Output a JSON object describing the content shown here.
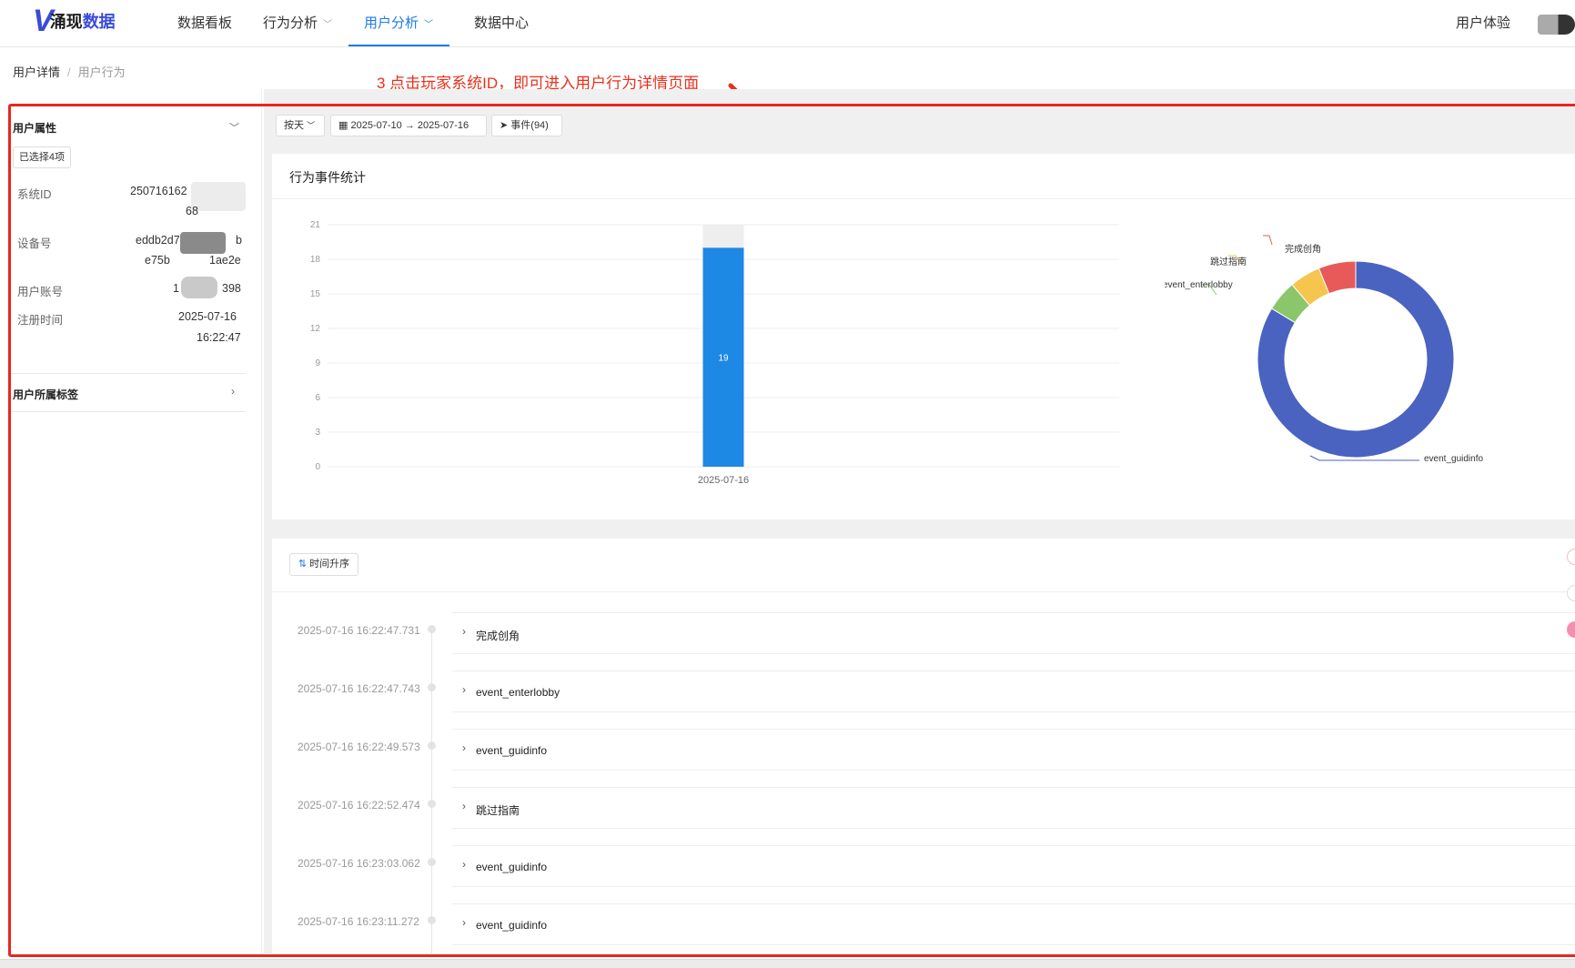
{
  "logo": {
    "mark": "V",
    "text_main": "涌现",
    "text_accent": "数据"
  },
  "nav": {
    "items": [
      {
        "label": "数据看板",
        "dropdown": false
      },
      {
        "label": "行为分析",
        "dropdown": true
      },
      {
        "label": "用户分析",
        "dropdown": true,
        "active": true
      },
      {
        "label": "数据中心",
        "dropdown": false
      }
    ],
    "user_experience": "用户体验"
  },
  "breadcrumb": {
    "current": "用户详情",
    "separator": "/",
    "sub": "用户行为"
  },
  "annotation": "3 点击玩家系统ID，即可进入用户行为详情页面",
  "user_panel": {
    "title": "用户属性",
    "selected_tag": "已选择4项",
    "attributes": [
      {
        "label": "系统ID",
        "value_line1": "250716162",
        "value_line2": "68"
      },
      {
        "label": "设备号",
        "value_line1": "eddb2d76",
        "value_line1_end": "b",
        "value_line2": "e75b",
        "value_line2_end": "1ae2e"
      },
      {
        "label": "用户账号",
        "value_line1": "1",
        "value_line1_end": "398"
      },
      {
        "label": "注册时间",
        "value_line1": "2025-07-16",
        "value_line2": "16:22:47"
      }
    ],
    "tags_title": "用户所属标签"
  },
  "filters": {
    "granularity": "按天",
    "date_range": "2025-07-10 → 2025-07-16",
    "events": "事件(94)"
  },
  "stats_card": {
    "title": "行为事件统计"
  },
  "chart_data": [
    {
      "type": "bar",
      "categories": [
        "2025-07-16"
      ],
      "values": [
        19
      ],
      "data_labels": [
        "19"
      ],
      "y_ticks": [
        0,
        3,
        6,
        9,
        12,
        15,
        18,
        21
      ],
      "ylim": [
        0,
        21
      ],
      "grid": true,
      "color": "#1e88e5"
    },
    {
      "type": "pie",
      "donut": true,
      "labels": [
        "event_guidinfo",
        "event_enterlobby",
        "跳过指南",
        "完成创角"
      ],
      "values": [
        82,
        5,
        5,
        6
      ],
      "colors": [
        "#4a63c0",
        "#8bc66b",
        "#f5c54e",
        "#e85a5a"
      ]
    }
  ],
  "event_list": {
    "sort_label": "时间升序",
    "events": [
      {
        "time": "2025-07-16 16:22:47.731",
        "name": "完成创角"
      },
      {
        "time": "2025-07-16 16:22:47.743",
        "name": "event_enterlobby"
      },
      {
        "time": "2025-07-16 16:22:49.573",
        "name": "event_guidinfo"
      },
      {
        "time": "2025-07-16 16:22:52.474",
        "name": "跳过指南"
      },
      {
        "time": "2025-07-16 16:23:03.062",
        "name": "event_guidinfo"
      },
      {
        "time": "2025-07-16 16:23:11.272",
        "name": "event_guidinfo"
      }
    ]
  },
  "colors": {
    "accent": "#1d7be8",
    "annotation": "#e8311f",
    "bar": "#1e88e5"
  }
}
